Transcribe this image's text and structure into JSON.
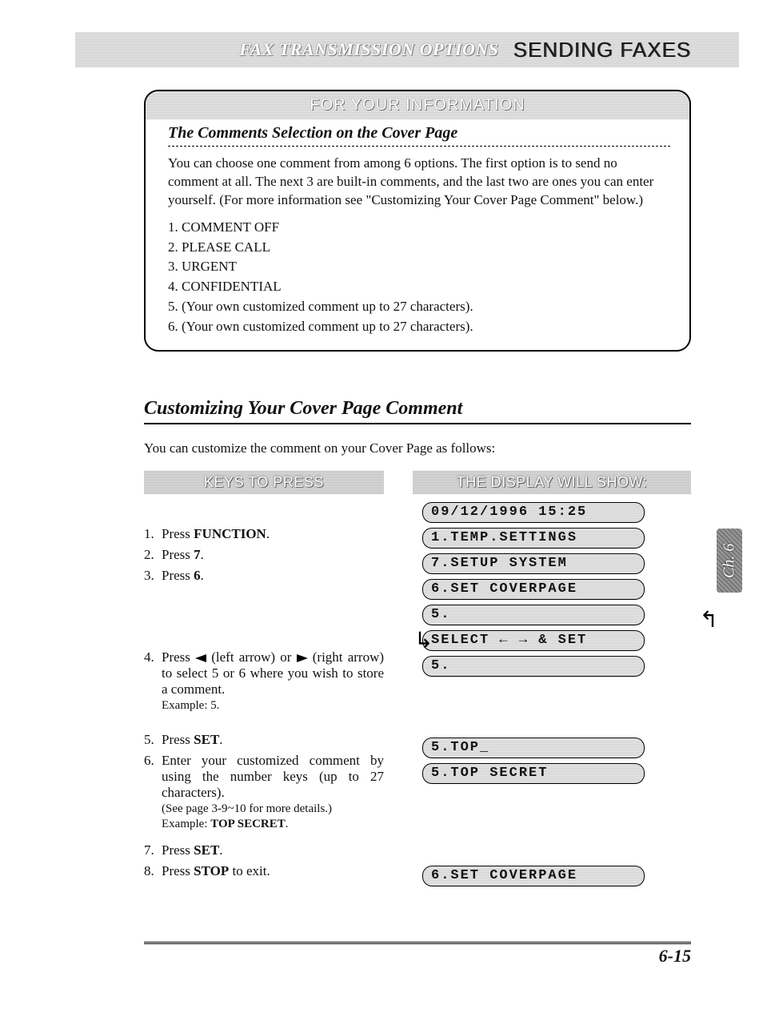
{
  "header": {
    "subtitle": "FAX TRANSMISSION OPTIONS",
    "title": "SENDING FAXES"
  },
  "fyi": {
    "banner": "FOR YOUR INFORMATION",
    "subtitle": "The Comments Selection on the Cover Page",
    "paragraph": "You can choose one comment from among 6 options. The first option is to send no comment at all. The next 3 are built-in comments, and the last two are ones you can enter yourself. (For more information see \"Customizing Your Cover Page Comment\" below.)",
    "items": [
      "1. COMMENT OFF",
      "2. PLEASE CALL",
      "3. URGENT",
      "4. CONFIDENTIAL",
      "5. (Your own customized comment up to 27 characters).",
      "6. (Your own customized comment up to 27 characters)."
    ]
  },
  "section": {
    "heading": "Customizing Your Cover Page Comment",
    "intro": "You can customize the comment on your Cover Page as follows:"
  },
  "columns": {
    "left_head": "KEYS TO PRESS",
    "right_head": "THE DISPLAY WILL SHOW:"
  },
  "steps": [
    {
      "n": "1.",
      "pre": "Press ",
      "bold": "FUNCTION",
      "post": "."
    },
    {
      "n": "2.",
      "pre": "Press ",
      "bold": "7",
      "post": "."
    },
    {
      "n": "3.",
      "pre": "Press ",
      "bold": "6",
      "post": "."
    },
    {
      "n": "4.",
      "text": "Press ◄ (left arrow) or ► (right arrow) to select 5 or 6 where you wish to store a comment.",
      "example": "Example: 5."
    },
    {
      "n": "5.",
      "pre": "Press ",
      "bold": "SET",
      "post": "."
    },
    {
      "n": "6.",
      "text": "Enter your customized comment by using the number keys (up to 27 characters).",
      "note": "(See page 3-9~10 for more details.)",
      "example_pre": "Example: ",
      "example_bold": "TOP SECRET",
      "example_post": "."
    },
    {
      "n": "7.",
      "pre": "Press ",
      "bold": "SET",
      "post": "."
    },
    {
      "n": "8.",
      "pre": "Press ",
      "bold": "STOP",
      "post": " to exit."
    }
  ],
  "display": {
    "initial": "09/12/1996 15:25",
    "s1": "1.TEMP.SETTINGS",
    "s2": "7.SETUP SYSTEM",
    "s3": "6.SET COVERPAGE",
    "s4a": "5.",
    "s4b": "SELECT ← → & SET",
    "s4c": "5.",
    "s5": "5.TOP_",
    "s6": "5.TOP SECRET",
    "s7": "6.SET COVERPAGE"
  },
  "tab": "Ch. 6",
  "page_number": "6-15",
  "chart_data": null
}
